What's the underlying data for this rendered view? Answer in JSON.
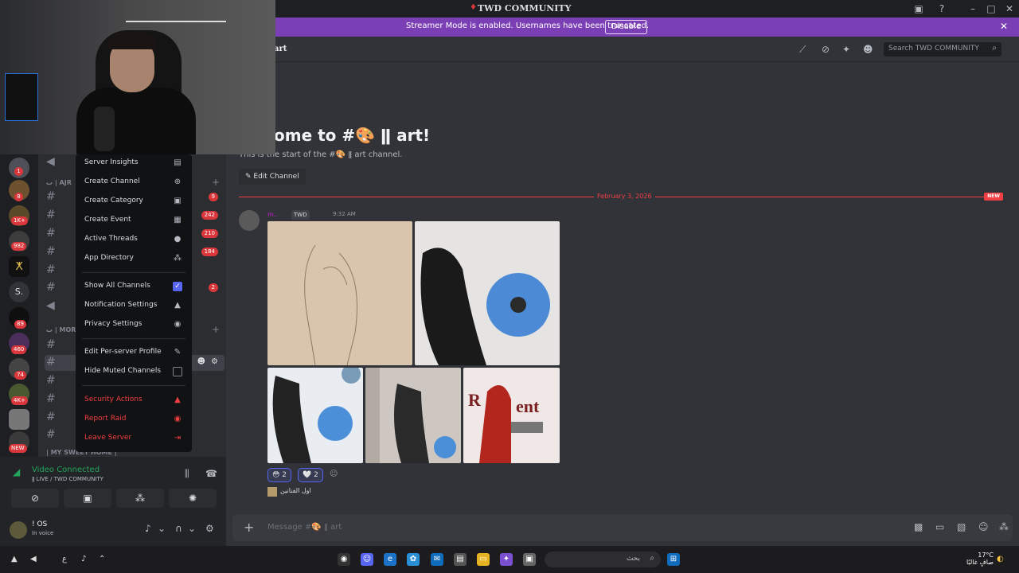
{
  "window": {
    "title": "TWD COMMUNITY"
  },
  "banner": {
    "text": "Streamer Mode is enabled. Usernames have been truncated.",
    "disable_label": "Disable"
  },
  "rail": {
    "badges": [
      "1",
      "8",
      "1K+",
      "982",
      "89",
      "460",
      "74",
      "4K+"
    ],
    "letter_server": "S.",
    "new_label": "NEW"
  },
  "sidebar": {
    "categories": [
      "ٮ | AJR",
      "ٮ | MORE",
      "| MY SWEET HOME | "
    ],
    "badges": [
      "9",
      "242",
      "210",
      "184",
      "2"
    ]
  },
  "context_menu": {
    "items": [
      {
        "label": "Server Insights",
        "icon": "insights-icon",
        "glyph": "▤"
      },
      {
        "label": "Create Channel",
        "icon": "plus-circle-icon",
        "glyph": "⊕"
      },
      {
        "label": "Create Category",
        "icon": "folder-plus-icon",
        "glyph": "▣"
      },
      {
        "label": "Create Event",
        "icon": "calendar-plus-icon",
        "glyph": "▦"
      },
      {
        "label": "Active Threads",
        "icon": "threads-icon",
        "glyph": "●"
      },
      {
        "label": "App Directory",
        "icon": "apps-icon",
        "glyph": "⁂"
      },
      {
        "label": "Show All Channels",
        "icon": "checkbox-checked-icon",
        "glyph": "✓"
      },
      {
        "label": "Notification Settings",
        "icon": "bell-icon",
        "glyph": "▲"
      },
      {
        "label": "Privacy Settings",
        "icon": "shield-icon",
        "glyph": "◉"
      },
      {
        "label": "Edit Per-server Profile",
        "icon": "pencil-icon",
        "glyph": "✎"
      },
      {
        "label": "Hide Muted Channels",
        "icon": "checkbox-empty-icon",
        "glyph": ""
      },
      {
        "label": "Security Actions",
        "icon": "lock-icon",
        "glyph": "🔒"
      },
      {
        "label": "Report Raid",
        "icon": "warning-icon",
        "glyph": "◉"
      },
      {
        "label": "Leave Server",
        "icon": "door-icon",
        "glyph": "⇥"
      }
    ]
  },
  "voice": {
    "status": "Video Connected",
    "channel": "ǁ LIVE / TWD COMMUNITY"
  },
  "user": {
    "name": "! OS",
    "status": "In voice"
  },
  "chat": {
    "channel_name": "art",
    "search_placeholder": "Search TWD COMMUNITY",
    "welcome": "ome to #🎨 ǁ art!",
    "welcome_sub": "This is the start of the #🎨 ǁ art channel.",
    "edit_channel": "Edit Channel",
    "date_divider": "February 3, 2026",
    "new_label": "NEW",
    "message": {
      "author": "m..",
      "tag": "TWD",
      "time": "9:32 AM",
      "reactions": [
        {
          "emoji": "😳",
          "count": "2"
        },
        {
          "emoji": "🤍",
          "count": "2"
        }
      ],
      "reply_text": "اول الفنانين"
    },
    "composer_placeholder": "Message #🎨 ǁ art"
  },
  "taskbar": {
    "search_placeholder": "بحث",
    "weather_temp": "17°C",
    "weather_desc": "صافٍ غالبًا",
    "lang": "ع"
  }
}
